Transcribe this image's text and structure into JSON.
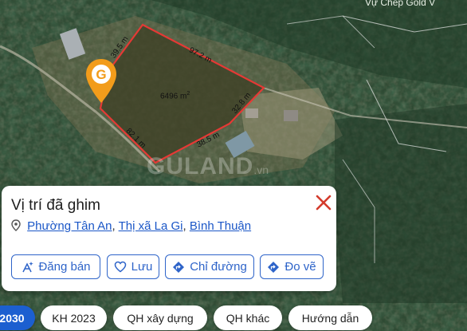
{
  "map": {
    "top_label": "Vự Chép Gold V",
    "watermark": "GULAND",
    "watermark_suffix": ".vn",
    "area_value": "6496 m",
    "area_unit_sup": "2",
    "dimensions": [
      "39.5 m",
      "97.2 m",
      "32.8 m",
      "38.5 m",
      "82.1 m"
    ],
    "pin_letter": "G"
  },
  "card": {
    "title": "Vị trí đã ghim",
    "address": {
      "ward": "Phường Tân An",
      "town": "Thị xã La Gi",
      "province": "Bình Thuận",
      "separator": ","
    },
    "buttons": {
      "post": "Đăng bán",
      "save": "Lưu",
      "directions": "Chỉ đường",
      "measure": "Đo vẽ"
    }
  },
  "chips": [
    "2030",
    "KH 2023",
    "QH xây dựng",
    "QH khác",
    "Hướng dẫn"
  ],
  "colors": {
    "accent": "#1c5fd0",
    "parcel_border": "#e53935",
    "pin": "#f29c1b",
    "close": "#d33b2c"
  }
}
